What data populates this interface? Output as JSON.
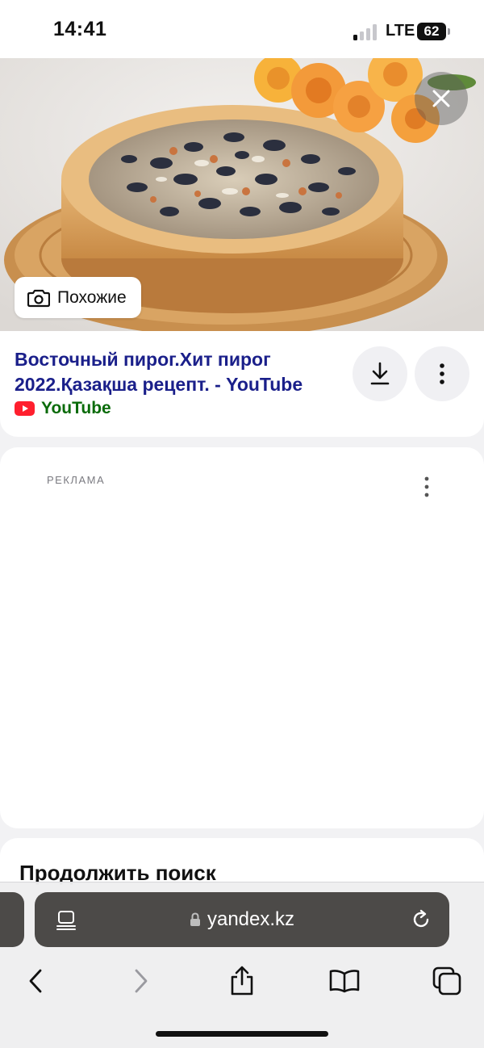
{
  "status_bar": {
    "time": "14:41",
    "network": "LTE",
    "battery": "62"
  },
  "hero": {
    "close_icon": "close-icon",
    "similar": {
      "label": "Похожие",
      "icon": "camera-icon"
    }
  },
  "result": {
    "title": "Восточный пирог.Хит пирог 2022.Қазақша рецепт. - YouTube",
    "source": "YouTube",
    "source_color": "#0a6b0a",
    "title_color": "#1a1f8a",
    "actions": [
      "download-icon",
      "more-vertical-icon"
    ]
  },
  "ad": {
    "label": "РЕКЛАМА"
  },
  "continue": {
    "title": "Продолжить поиск"
  },
  "browser": {
    "url": "yandex.kz",
    "toolbar": [
      "back-icon",
      "forward-icon",
      "share-icon",
      "bookmarks-icon",
      "tabs-icon"
    ]
  }
}
